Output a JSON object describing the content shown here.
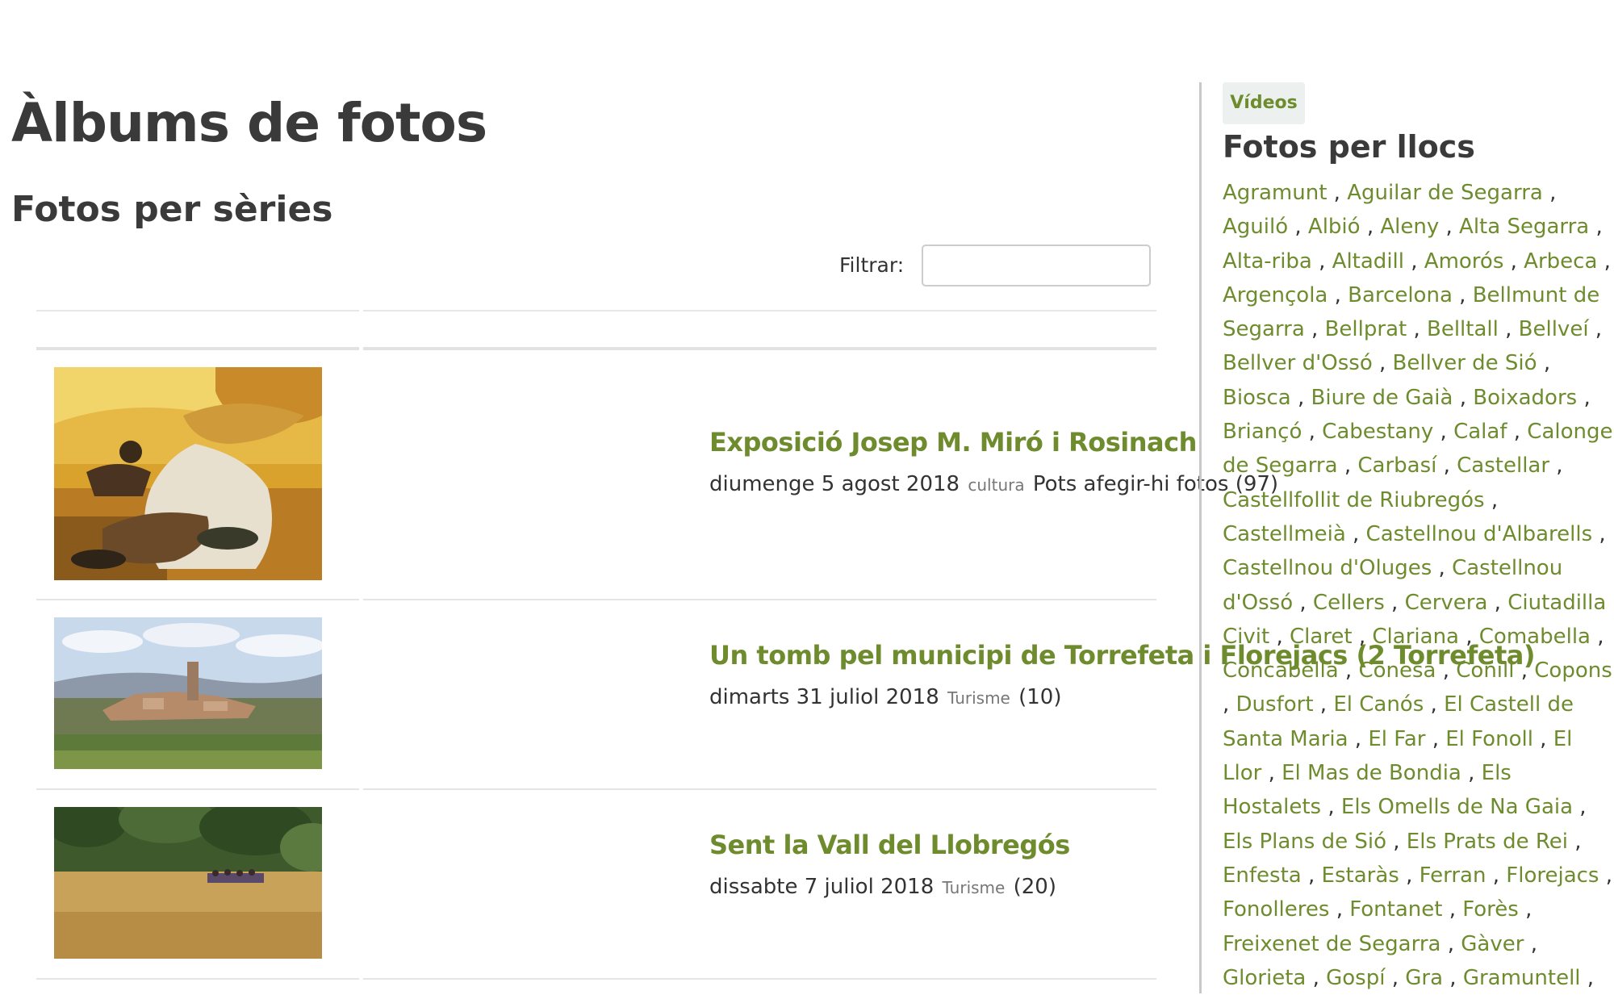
{
  "page_title": "Àlbums de fotos",
  "series_heading": "Fotos per sèries",
  "filter": {
    "label": "Filtrar:",
    "value": "",
    "placeholder": ""
  },
  "albums": [
    {
      "title": "Exposició Josep M. Miró i Rosinach",
      "date": "diumenge 5 agost 2018",
      "category": "cultura",
      "extra": "Pots afegir-hi fotos",
      "count": "(97)"
    },
    {
      "title": "Un tomb pel municipi de Torrefeta i Florejacs (2 Torrefeta)",
      "date": "dimarts 31 juliol 2018",
      "category": "Turisme",
      "count": "(10)"
    },
    {
      "title": "Sent la Vall del Llobregós",
      "date": "dissabte 7 juliol 2018",
      "category": "Turisme",
      "count": "(20)"
    }
  ],
  "sidebar": {
    "videos_tab": "Vídeos",
    "heading": "Fotos per llocs",
    "places": [
      "Agramunt",
      "Aguilar de Segarra",
      "Aguiló",
      "Albió",
      "Aleny",
      "Alta Segarra",
      "Alta-riba",
      "Altadill",
      "Amorós",
      "Arbeca",
      "Argençola",
      "Barcelona",
      "Bellmunt de Segarra",
      "Bellprat",
      "Belltall",
      "Bellveí",
      "Bellver d'Ossó",
      "Bellver de Sió",
      "Biosca",
      "Biure de Gaià",
      "Boixadors",
      "Briançó",
      "Cabestany",
      "Calaf",
      "Calonge de Segarra",
      "Carbasí",
      "Castellar",
      "Castellfollit de Riubregós",
      "Castellmeià",
      "Castellnou d'Albarells",
      "Castellnou d'Oluges",
      "Castellnou d'Ossó",
      "Cellers",
      "Cervera",
      "Ciutadilla",
      "Civit",
      "Claret",
      "Clariana",
      "Comabella",
      "Concabella",
      "Conesa",
      "Conill",
      "Copons",
      "Dusfort",
      "El Canós",
      "El Castell de Santa Maria",
      "El Far",
      "El Fonoll",
      "El Llor",
      "El Mas de Bondia",
      "Els Hostalets",
      "Els Omells de Na Gaia",
      "Els Plans de Sió",
      "Els Prats de Rei",
      "Enfesta",
      "Estaràs",
      "Ferran",
      "Florejacs",
      "Fonolleres",
      "Fontanet",
      "Forès",
      "Freixenet de Segarra",
      "Gàver",
      "Glorieta",
      "Gospí",
      "Gra",
      "Gramuntell"
    ]
  },
  "colors": {
    "link": "#6e8c2e",
    "heading": "#3a3a3a",
    "text": "#333333",
    "tab_bg": "#ecf0ee"
  }
}
